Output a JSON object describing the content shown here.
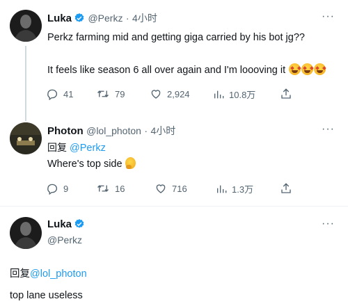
{
  "tweet1": {
    "name": "Luka",
    "handle": "@Perkz",
    "dot": "·",
    "time": "4小时",
    "line1": "Perkz farming mid and getting giga carried by his bot jg??",
    "line2": "It feels like season 6 all over again and I'm loooving it",
    "replies": "41",
    "retweets": "79",
    "likes": "2,924",
    "views": "10.8万",
    "more": "···"
  },
  "tweet2": {
    "name": "Photon",
    "handle": "@lol_photon",
    "dot": "·",
    "time": "4小时",
    "reply_prefix": "回复",
    "reply_to": "@Perkz",
    "text": "Where's top side",
    "replies": "9",
    "retweets": "16",
    "likes": "716",
    "views": "1.3万",
    "more": "···"
  },
  "tweet3": {
    "name": "Luka",
    "handle": "@Perkz",
    "reply_prefix": "回复",
    "reply_to": "@lol_photon",
    "text": "top lane useless",
    "more": "···"
  },
  "colors": {
    "accent": "#1d9bf0",
    "muted": "#536471",
    "text": "#0f1419"
  },
  "icons": [
    "reply-icon",
    "retweet-icon",
    "like-icon",
    "views-icon",
    "share-icon",
    "verified-icon",
    "more-icon"
  ]
}
